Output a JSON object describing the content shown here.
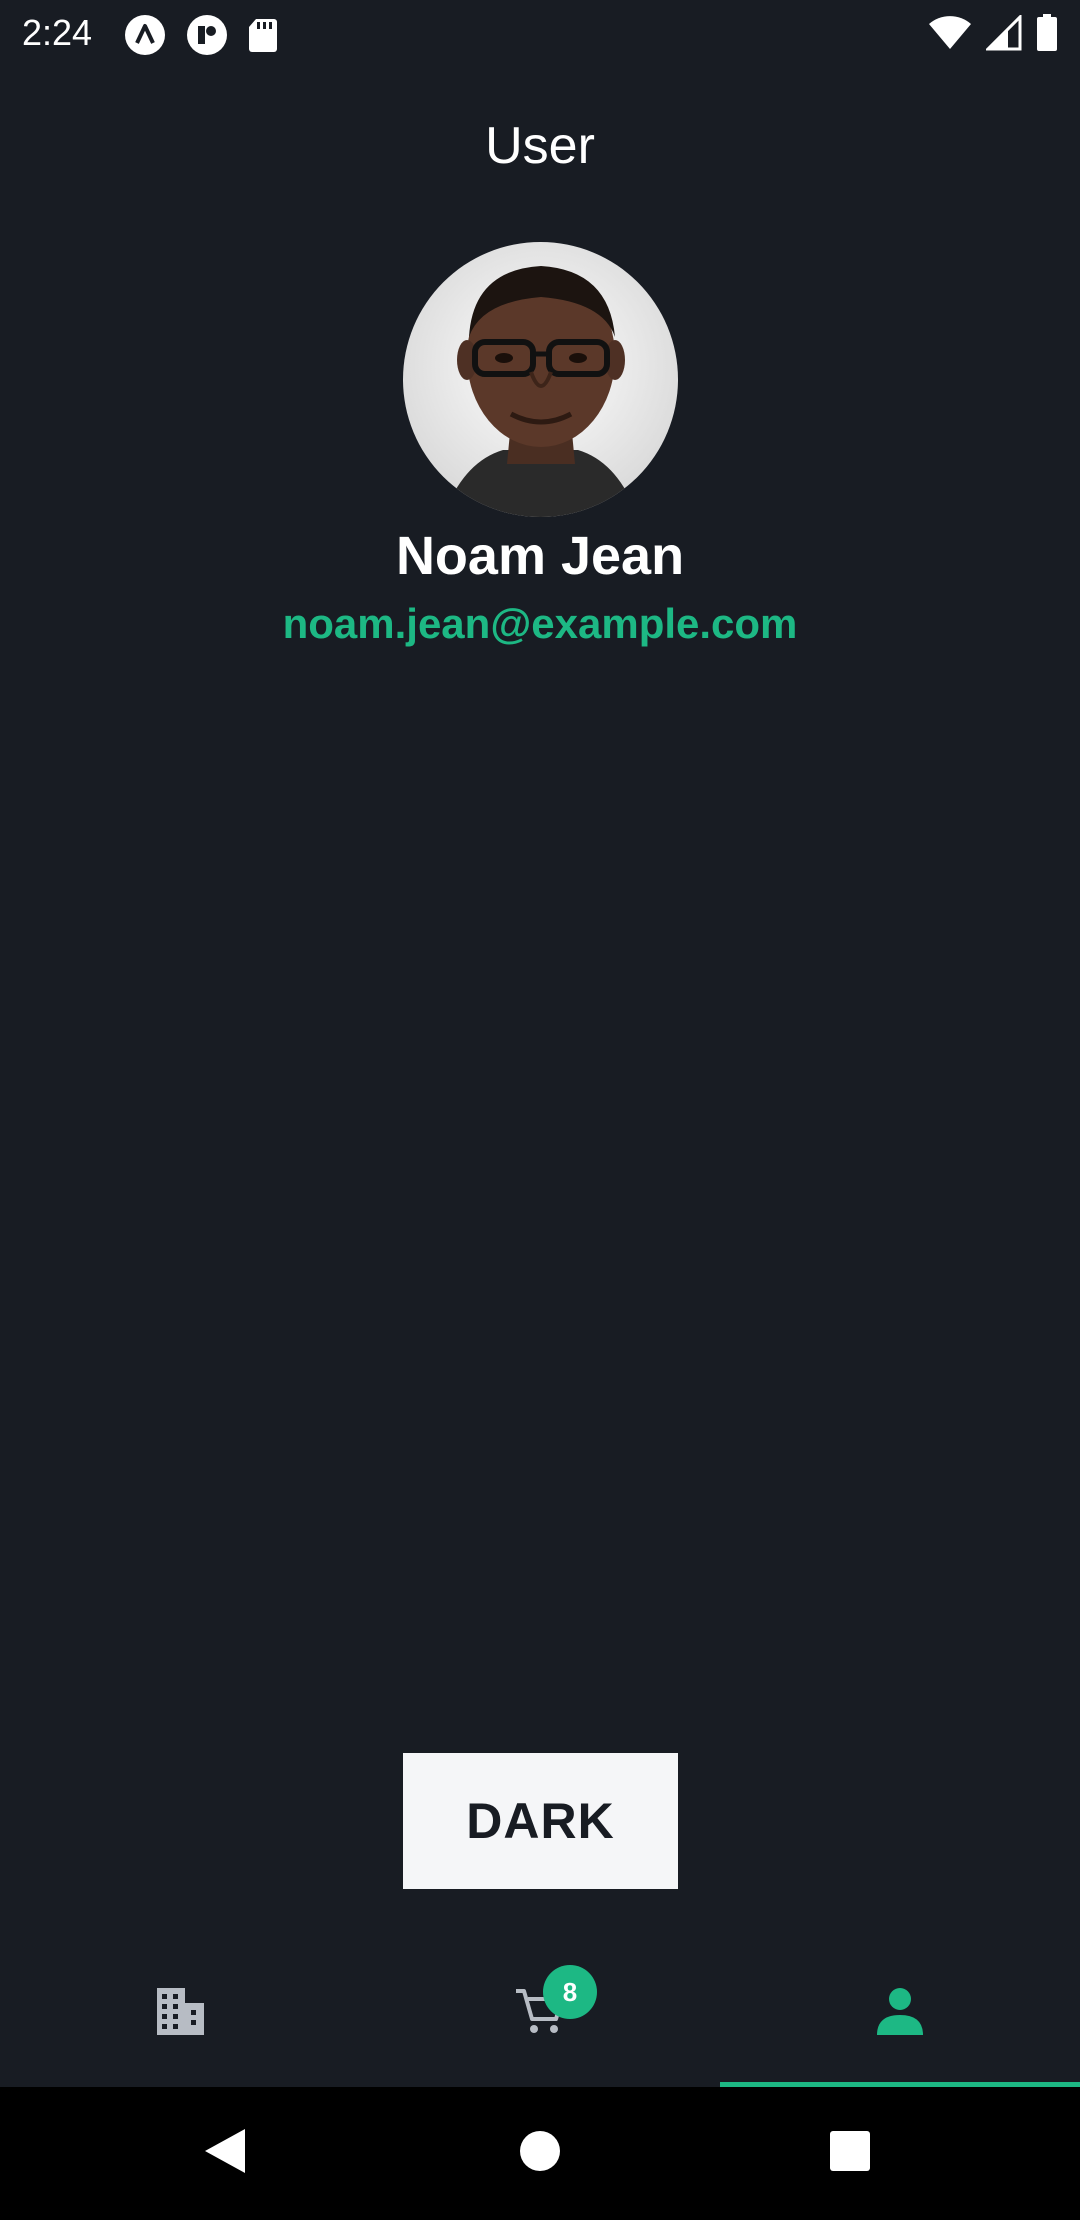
{
  "status_bar": {
    "time": "2:24",
    "left_icons": [
      "app-notification-icon",
      "app-notification-icon-2",
      "sd-card-icon"
    ],
    "right_icons": [
      "wifi-icon",
      "signal-icon",
      "battery-icon"
    ]
  },
  "header": {
    "title": "User"
  },
  "profile": {
    "avatar": "user-avatar-photo",
    "name": "Noam Jean",
    "email": "noam.jean@example.com"
  },
  "theme_button": {
    "label": "DARK"
  },
  "tab_bar": {
    "tabs": [
      {
        "icon": "building-icon",
        "active": false
      },
      {
        "icon": "cart-icon",
        "active": false,
        "badge": "8"
      },
      {
        "icon": "person-icon",
        "active": true
      }
    ]
  },
  "colors": {
    "background": "#181c23",
    "accent": "#1db884",
    "text": "#ffffff",
    "inactive_icon": "#b7bcc4",
    "button_bg": "#f5f6f8"
  },
  "nav_bar": {
    "buttons": [
      "back-icon",
      "home-icon",
      "recents-icon"
    ]
  }
}
